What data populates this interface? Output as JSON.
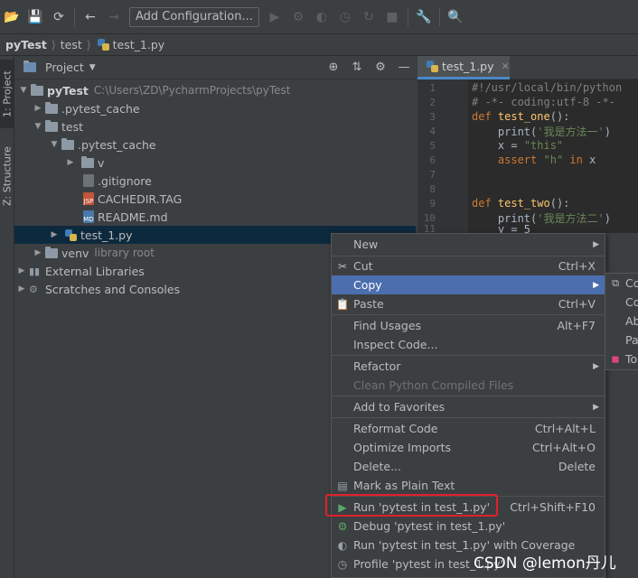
{
  "toolbar": {
    "config_label": "Add Configuration..."
  },
  "breadcrumb": [
    "pyTest",
    "test",
    "test_1.py"
  ],
  "stripe": {
    "project_tab": "1: Project",
    "structure_tab": "Z: Structure"
  },
  "project_panel": {
    "title": "Project",
    "tree": [
      {
        "label": "pyTest",
        "path": "C:\\Users\\ZD\\PycharmProjects\\pyTest"
      },
      {
        "label": ".pytest_cache"
      },
      {
        "label": "test"
      },
      {
        "label": ".pytest_cache"
      },
      {
        "label": "v"
      },
      {
        "label": ".gitignore"
      },
      {
        "label": "CACHEDIR.TAG"
      },
      {
        "label": "README.md"
      },
      {
        "label": "test_1.py"
      },
      {
        "label": "venv",
        "path": "library root"
      },
      {
        "label": "External Libraries"
      },
      {
        "label": "Scratches and Consoles"
      }
    ]
  },
  "editor": {
    "tab_label": "test_1.py",
    "line_numbers": [
      "1",
      "2",
      "3",
      "4",
      "5",
      "6",
      "7",
      "8",
      "9",
      "10",
      "11"
    ],
    "lines": {
      "l1": "#!/usr/local/bin/python",
      "l2": "# -*- coding:utf-8 -*-",
      "def": "def",
      "fn_one": "test_one",
      "fn_two": "test_two",
      "paren_colon": "():",
      "print": "print(",
      "str_one": "'我是方法一'",
      "str_two": "'我是方法二'",
      "close_paren": ")",
      "x_assign": "x = ",
      "str_this": "\"this\"",
      "assert": "assert",
      "str_h": "\"h\"",
      "in": "in",
      "x": "x",
      "l11": "y = 5"
    }
  },
  "context_menu": {
    "items": [
      {
        "label": "New",
        "shortcut": ""
      },
      {
        "label": "Cut",
        "shortcut": "Ctrl+X"
      },
      {
        "label": "Copy",
        "shortcut": ""
      },
      {
        "label": "Paste",
        "shortcut": "Ctrl+V"
      },
      {
        "label": "Find Usages",
        "shortcut": "Alt+F7"
      },
      {
        "label": "Inspect Code...",
        "shortcut": ""
      },
      {
        "label": "Refactor",
        "shortcut": ""
      },
      {
        "label": "Clean Python Compiled Files",
        "shortcut": ""
      },
      {
        "label": "Add to Favorites",
        "shortcut": ""
      },
      {
        "label": "Reformat Code",
        "shortcut": "Ctrl+Alt+L"
      },
      {
        "label": "Optimize Imports",
        "shortcut": "Ctrl+Alt+O"
      },
      {
        "label": "Delete...",
        "shortcut": "Delete"
      },
      {
        "label": "Mark as Plain Text",
        "shortcut": ""
      },
      {
        "label": "Run 'pytest in test_1.py'",
        "shortcut": "Ctrl+Shift+F10"
      },
      {
        "label": "Debug 'pytest in test_1.py'",
        "shortcut": ""
      },
      {
        "label": "Run 'pytest in test_1.py' with Coverage",
        "shortcut": ""
      },
      {
        "label": "Profile 'pytest in test_1.py'",
        "shortcut": ""
      }
    ]
  },
  "copy_submenu": {
    "items": [
      "Co",
      "Co",
      "Ab",
      "Pa",
      "To"
    ]
  },
  "watermark": "CSDN @lemon丹儿",
  "colors": {
    "background": "#3c3f41",
    "editor_bg": "#2b2b2b",
    "selection": "#4b6eaf",
    "highlight_box": "#e0202a"
  }
}
